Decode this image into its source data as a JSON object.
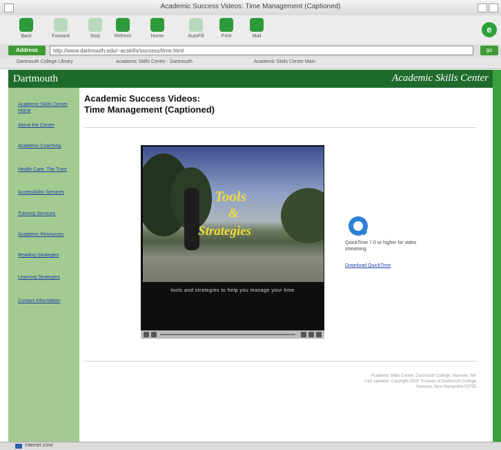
{
  "window": {
    "title": "Academic Success Videos: Time Management (Captioned)"
  },
  "toolbar": {
    "buttons": [
      {
        "label": "Back",
        "icon": "back-arrow-icon"
      },
      {
        "label": "Forward",
        "icon": "forward-arrow-icon"
      },
      {
        "label": "Stop",
        "icon": "stop-icon"
      },
      {
        "label": "Refresh",
        "icon": "refresh-icon"
      },
      {
        "label": "Home",
        "icon": "home-icon"
      },
      {
        "label": "AutoFill",
        "icon": "autofill-icon"
      },
      {
        "label": "Print",
        "icon": "print-icon"
      },
      {
        "label": "Mail",
        "icon": "mail-icon"
      }
    ]
  },
  "location": {
    "go_label": "Address",
    "url": "http://www.dartmouth.edu/~acskills/success/time.html",
    "go_button": "go"
  },
  "bookmarks": {
    "items": [
      "Dartmouth College Library",
      "Academic Skills Center - Dartmouth",
      "Academic Skills Center Main"
    ]
  },
  "site": {
    "logo": "Dartmouth",
    "department": "Academic Skills Center"
  },
  "sidebar": {
    "items": [
      "Academic Skills Center Home",
      "About the Center",
      "Academic Coaching",
      "Health Care, The Tutor",
      "Accessibility Services",
      "Tutoring Services",
      "Academic Resources",
      "Reading Strategies",
      "Learning Strategies",
      "Contact Information"
    ]
  },
  "main": {
    "title_line1": "Academic Success Videos:",
    "title_line2": "Time Management (Captioned)"
  },
  "video": {
    "title_line1": "Tools",
    "title_line2": "&",
    "title_line3": "Strategies",
    "caption": "tools and strategies to help you manage your time"
  },
  "quicktime": {
    "text": "QuickTime 7.0 or higher for video streaming",
    "link": "Download QuickTime"
  },
  "footer": {
    "line1": "Academic Skills Center, Dartmouth College, Hanover, NH",
    "line2": "Last updated: Copyright 2005 Trustees of Dartmouth College",
    "line3": "Hanover, New Hampshire 03755"
  },
  "status": {
    "text": "Internet zone"
  },
  "colors": {
    "brand_green": "#1f6b2c",
    "sidebar_green": "#a3cb91",
    "link_blue": "#1d3fa6",
    "title_yellow": "#f0dc3c"
  }
}
